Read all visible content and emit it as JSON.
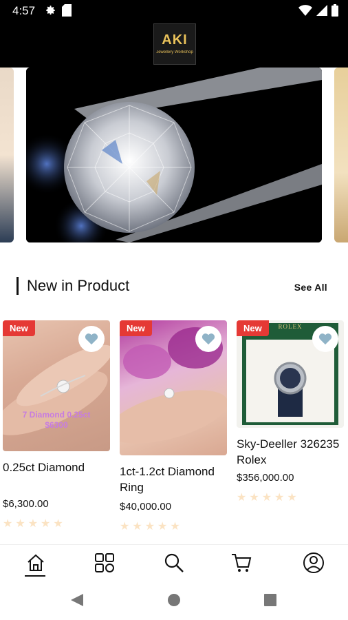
{
  "status_bar": {
    "time": "4:57",
    "icons_left": [
      "gear-icon",
      "sd-card-icon"
    ],
    "icons_right": [
      "wifi-icon",
      "signal-icon",
      "battery-icon"
    ]
  },
  "header": {
    "logo_text": "AKI",
    "logo_subtext": "Jewellery Workshop"
  },
  "banner": {
    "slides": [
      "diamond-in-tweezers"
    ],
    "colors": {
      "background": "#000000"
    }
  },
  "section": {
    "title": "New in Product",
    "see_all": "See All"
  },
  "products": [
    {
      "badge": "New",
      "name": "0.25ct Diamond",
      "price": "$6,300.00",
      "image_caption_line1": "7 Diamond 0.25ct",
      "image_caption_line2": "$6300",
      "rating": 0
    },
    {
      "badge": "New",
      "name": "1ct-1.2ct Diamond Ring",
      "price": "$40,000.00",
      "rating": 0
    },
    {
      "badge": "New",
      "name": "Sky-Deeller 326235 Rolex",
      "price": "$356,000.00",
      "image_brand": "ROLEX",
      "rating": 0
    }
  ],
  "bottom_nav": {
    "items": [
      "home-icon",
      "categories-icon",
      "search-icon",
      "cart-icon",
      "profile-icon"
    ],
    "active": "home-icon"
  },
  "colors": {
    "badge": "#e53935",
    "star": "#fbe3c3",
    "logo_gold": "#e8c15a",
    "fav_heart": "#8fb3c7"
  }
}
